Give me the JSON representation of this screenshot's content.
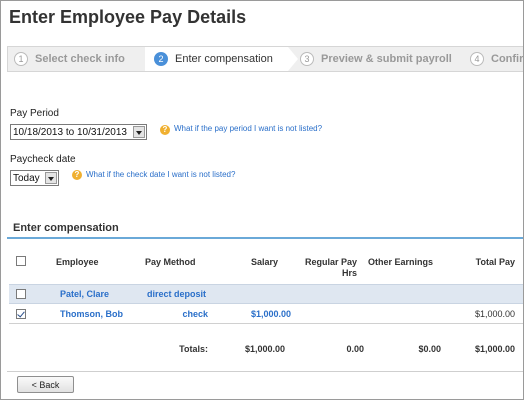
{
  "page": {
    "title": "Enter Employee Pay Details"
  },
  "wizard": {
    "steps": [
      {
        "num": "1",
        "label": "Select check info"
      },
      {
        "num": "2",
        "label": "Enter compensation"
      },
      {
        "num": "3",
        "label": "Preview & submit payroll"
      },
      {
        "num": "4",
        "label": "Confir"
      }
    ]
  },
  "pay_period": {
    "label": "Pay Period",
    "value": "10/18/2013 to 10/31/2013",
    "help": "What if the pay period I want is not listed?"
  },
  "paycheck_date": {
    "label": "Paycheck date",
    "value": "Today",
    "help": "What if the check date I want is not listed?"
  },
  "compensation": {
    "title": "Enter compensation",
    "headers": {
      "employee": "Employee",
      "pay_method": "Pay Method",
      "salary": "Salary",
      "regular_pay_hrs_1": "Regular Pay",
      "regular_pay_hrs_2": "Hrs",
      "other_earnings": "Other Earnings",
      "total_pay": "Total Pay"
    },
    "rows": [
      {
        "checked": false,
        "employee": "Patel, Clare",
        "pay_method": "direct deposit",
        "salary": "",
        "total_pay": ""
      },
      {
        "checked": true,
        "employee": "Thomson, Bob",
        "pay_method": "check",
        "salary": "$1,000.00",
        "total_pay": "$1,000.00"
      }
    ],
    "totals": {
      "label": "Totals:",
      "salary": "$1,000.00",
      "regular_pay_hrs": "0.00",
      "other_earnings": "$0.00",
      "total_pay": "$1,000.00"
    }
  },
  "buttons": {
    "back": "< Back"
  }
}
